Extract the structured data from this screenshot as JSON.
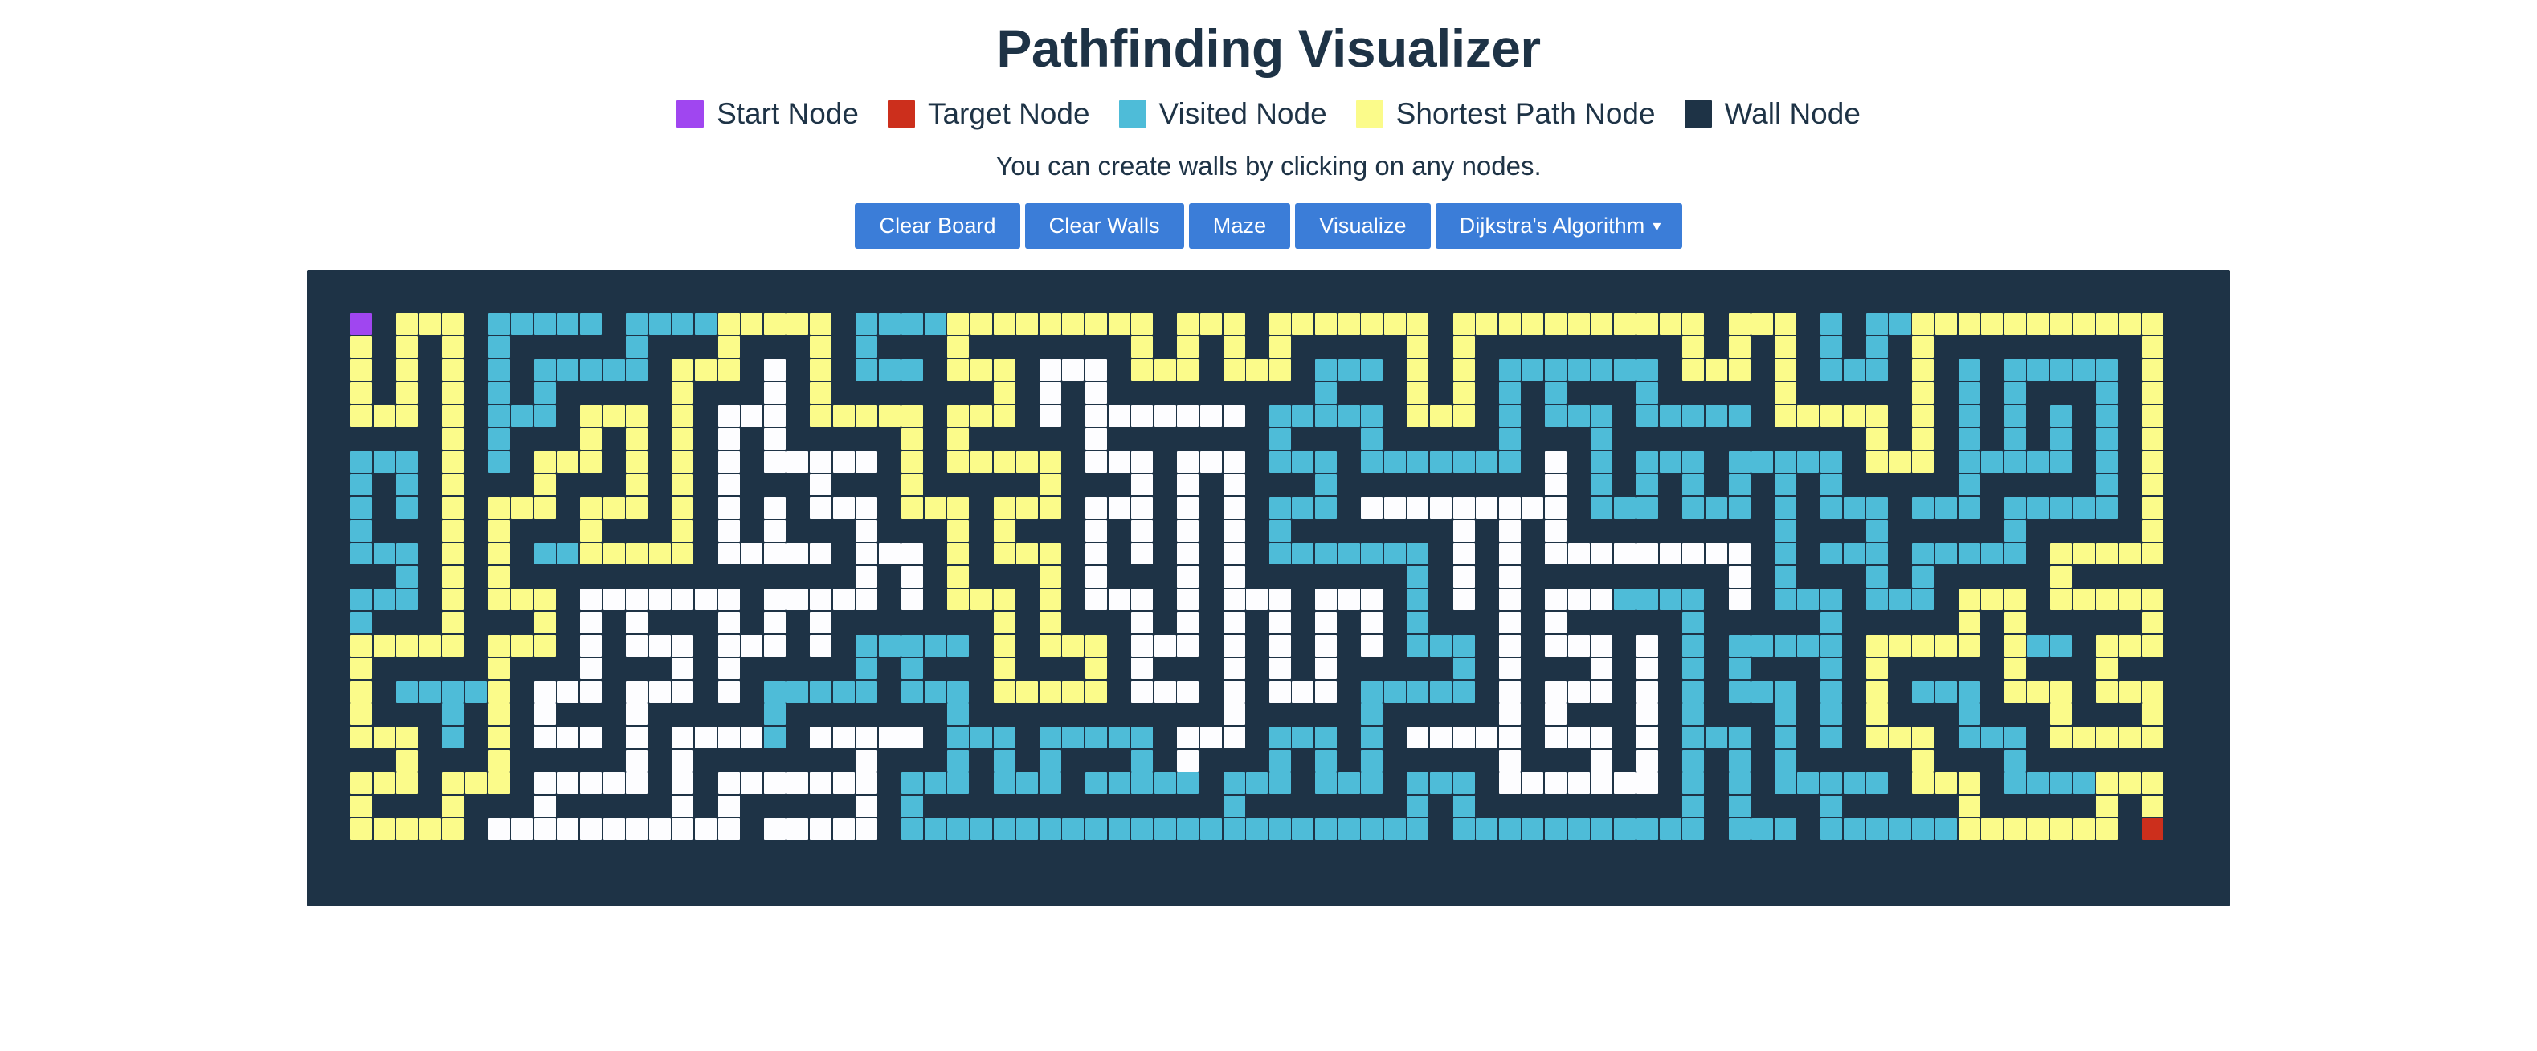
{
  "header": {
    "title": "Pathfinding Visualizer"
  },
  "legend": {
    "items": [
      {
        "label": "Start Node",
        "color": "#a046f0",
        "name": "start-node"
      },
      {
        "label": "Target Node",
        "color": "#cc2f1c",
        "name": "target-node"
      },
      {
        "label": "Visited Node",
        "color": "#4ebcd8",
        "name": "visited-node"
      },
      {
        "label": "Shortest Path Node",
        "color": "#fbfb8a",
        "name": "shortest-path-node"
      },
      {
        "label": "Wall Node",
        "color": "#1e3346",
        "name": "wall-node"
      }
    ]
  },
  "hint": {
    "text": "You can create walls by clicking on any nodes."
  },
  "toolbar": {
    "clear_board_label": "Clear Board",
    "clear_walls_label": "Clear Walls",
    "maze_label": "Maze",
    "visualize_label": "Visualize",
    "algorithm_label": "Dijkstra's Algorithm",
    "algorithm_caret": "▾",
    "button_color": "#3b7dd8",
    "button_text_color": "#ffffff"
  },
  "grid": {
    "columns": 82,
    "rows": 26,
    "cell_size_px": 28.6,
    "wall_color": "#1e3346",
    "visited_color": "#4ebcd8",
    "path_color": "#fbfb8a",
    "unvisited_color": "#fdfdff",
    "start_color": "#a046f0",
    "target_color": "#cc2f1c",
    "start_node": {
      "row": 1,
      "col": 1
    },
    "target_node": {
      "row": 24,
      "col": 80
    },
    "maze_seed": 20240517,
    "visited_fraction": 0.72,
    "algorithm": "Dijkstra's Algorithm"
  }
}
